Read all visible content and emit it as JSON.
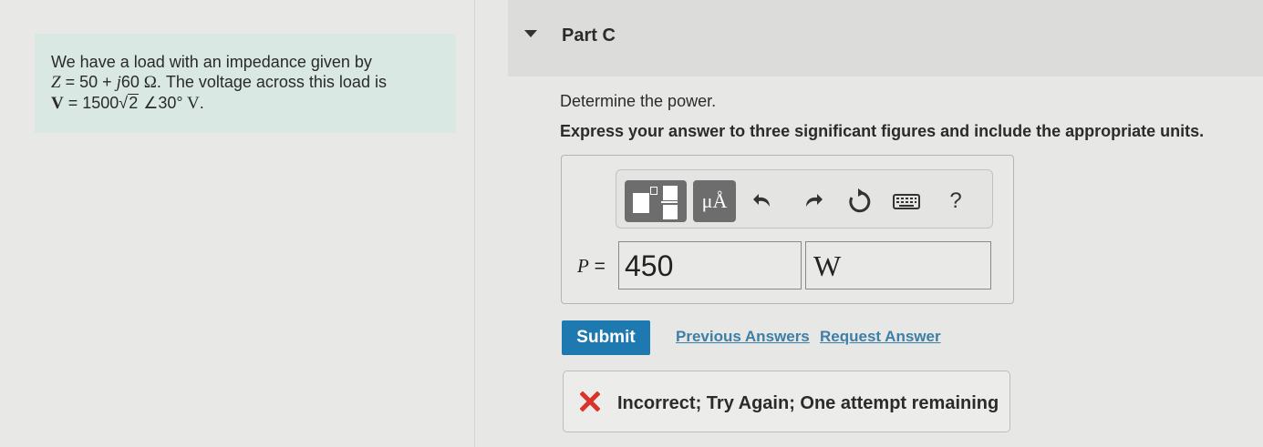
{
  "problem": {
    "line1": "We have a load with an impedance given by",
    "z_var": "Z",
    "z_eq": " = 50 + ",
    "z_j": "j",
    "z_val": "60",
    "z_unit": " Ω",
    "line2_rest": ". The voltage across this load is",
    "v_var": "V",
    "v_eq": " = 1500",
    "v_sqrt": "2",
    "v_angle": " ∠30°",
    "v_unit": " V",
    "v_end": "."
  },
  "part": {
    "title": "Part C",
    "question": "Determine the power.",
    "instructions": "Express your answer to three significant figures and include the appropriate units."
  },
  "toolbar": {
    "units_label": "μÅ",
    "undo_icon": "undo-icon",
    "redo_icon": "redo-icon",
    "reset_icon": "reset-icon",
    "keyboard_icon": "keyboard-icon",
    "help_label": "?"
  },
  "answer": {
    "label": "P =",
    "value": "450",
    "unit": "W"
  },
  "actions": {
    "submit": "Submit",
    "previous": "Previous Answers",
    "request": "Request Answer"
  },
  "feedback": {
    "text": "Incorrect; Try Again; One attempt remaining",
    "icon_color": "#d9342b"
  },
  "colors": {
    "accent": "#1e79b1",
    "link": "#3d7fa6",
    "problem_bg": "#d9e8e3"
  }
}
